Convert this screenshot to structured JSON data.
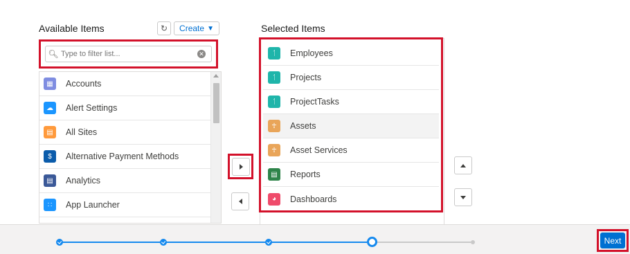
{
  "available": {
    "title": "Available Items",
    "create_label": "Create",
    "filter_placeholder": "Type to filter list...",
    "items": [
      {
        "label": "Accounts",
        "icon": "accounts-icon",
        "color": "#7f8de1"
      },
      {
        "label": "Alert Settings",
        "icon": "cloud-icon",
        "color": "#1b96ff"
      },
      {
        "label": "All Sites",
        "icon": "sites-icon",
        "color": "#ff9a3c"
      },
      {
        "label": "Alternative Payment Methods",
        "icon": "payment-icon",
        "color": "#0b5cab"
      },
      {
        "label": "Analytics",
        "icon": "analytics-icon",
        "color": "#3b5998"
      },
      {
        "label": "App Launcher",
        "icon": "app-launcher-icon",
        "color": "#1b96ff"
      }
    ]
  },
  "selected": {
    "title": "Selected Items",
    "items": [
      {
        "label": "Employees",
        "icon": "people-icon",
        "color": "#1fb5aa"
      },
      {
        "label": "Projects",
        "icon": "people-icon",
        "color": "#1fb5aa"
      },
      {
        "label": "ProjectTasks",
        "icon": "people-icon",
        "color": "#1fb5aa"
      },
      {
        "label": "Assets",
        "icon": "bank-icon",
        "color": "#e9a559",
        "highlighted": true
      },
      {
        "label": "Asset Services",
        "icon": "bank-icon",
        "color": "#e9a559"
      },
      {
        "label": "Reports",
        "icon": "report-icon",
        "color": "#2e844a"
      },
      {
        "label": "Dashboards",
        "icon": "dashboard-icon",
        "color": "#ef4b6b"
      }
    ]
  },
  "footer": {
    "next_label": "Next",
    "progress": {
      "steps_total": 5,
      "completed": 3,
      "current_step": 4
    }
  },
  "colors": {
    "accent": "#0070d2",
    "highlight_border": "#d3112a",
    "progress": "#1589ee"
  }
}
